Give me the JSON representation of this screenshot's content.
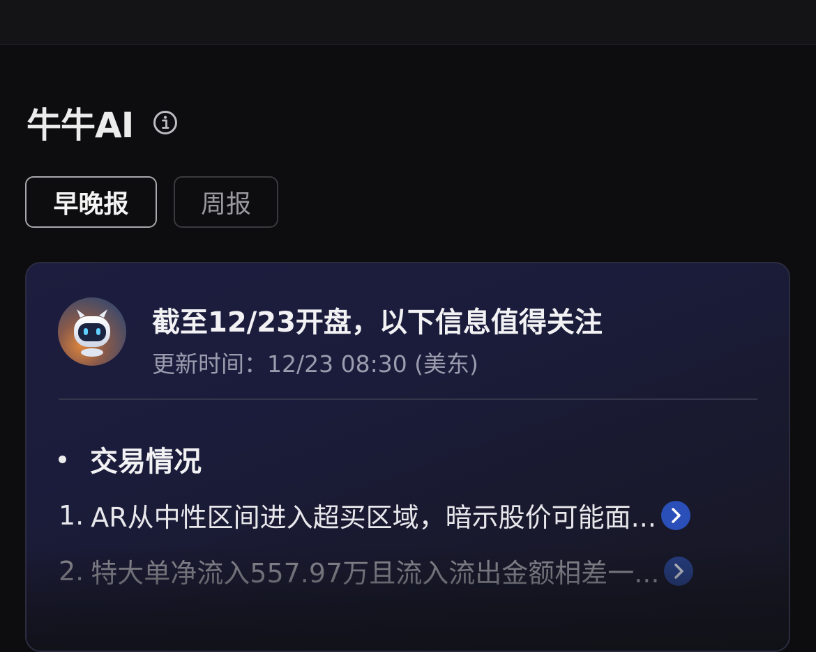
{
  "section": {
    "title": "牛牛AI",
    "info_icon": "info-circle-icon"
  },
  "tabs": [
    {
      "label": "早晚报",
      "active": true
    },
    {
      "label": "周报",
      "active": false
    }
  ],
  "card": {
    "avatar_icon": "robot-avatar-icon",
    "title": "截至12/23开盘，以下信息值得关注",
    "updated": "更新时间：12/23 08:30 (美东)",
    "bullet_heading": "交易情况",
    "items": [
      {
        "num": "1.",
        "text": "AR从中性区间进入超买区域，暗示股价可能面...",
        "icon": "chevron-right-icon"
      },
      {
        "num": "2.",
        "text": "特大单净流入557.97万且流入流出金额相差一...",
        "icon": "chevron-right-icon"
      }
    ]
  },
  "colors": {
    "background": "#0d0d0f",
    "card_bg": "#1d1d3f",
    "accent_blue": "#2b5bd6"
  }
}
